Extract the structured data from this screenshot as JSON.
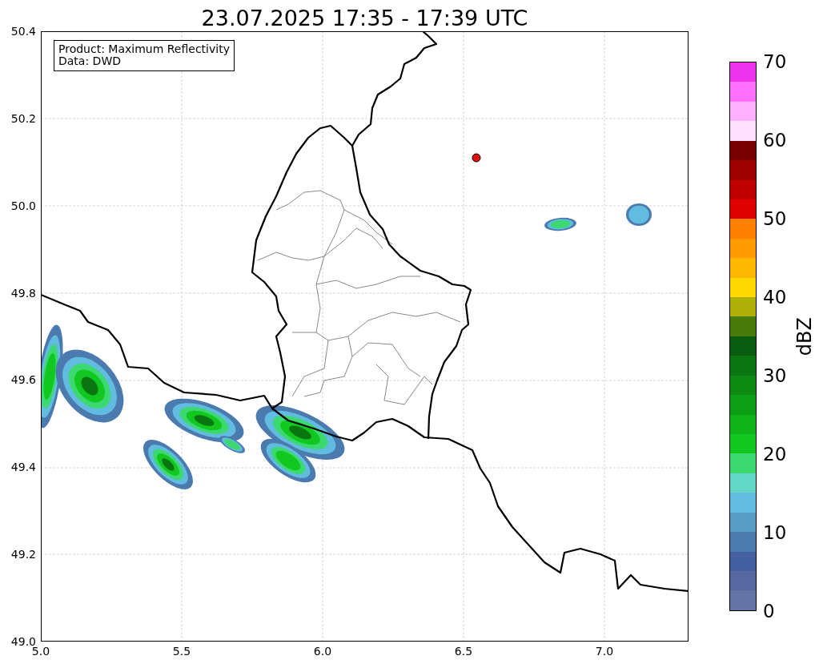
{
  "title": "23.07.2025 17:35 - 17:39 UTC",
  "legend": [
    "Product: Maximum Reflectivity",
    "Data: DWD"
  ],
  "map": {
    "xticks": [
      "5.0",
      "5.5",
      "6.0",
      "6.5",
      "7.0"
    ],
    "yticks": [
      "50.4",
      "50.2",
      "50.0",
      "49.8",
      "49.6",
      "49.4",
      "49.2",
      "49.0"
    ]
  },
  "colorbar": {
    "label": "dBZ",
    "ticks": [
      "70",
      "60",
      "50",
      "40",
      "30",
      "20",
      "10",
      "0"
    ],
    "bins": [
      {
        "color": "#ee33ee"
      },
      {
        "color": "#ff70ff"
      },
      {
        "color": "#ffb0ff"
      },
      {
        "color": "#ffe0ff"
      },
      {
        "color": "#780000"
      },
      {
        "color": "#a00000"
      },
      {
        "color": "#c00000"
      },
      {
        "color": "#e00000"
      },
      {
        "color": "#ff8000"
      },
      {
        "color": "#ff9a00"
      },
      {
        "color": "#ffb800"
      },
      {
        "color": "#ffd800"
      },
      {
        "color": "#b0b00a"
      },
      {
        "color": "#4a7a0a"
      },
      {
        "color": "#0a5c10"
      },
      {
        "color": "#0a7612"
      },
      {
        "color": "#0c8a12"
      },
      {
        "color": "#0e9e16"
      },
      {
        "color": "#10b418"
      },
      {
        "color": "#12c820"
      },
      {
        "color": "#3cd870"
      },
      {
        "color": "#62d8c8"
      },
      {
        "color": "#62bce0"
      },
      {
        "color": "#5a9ec8"
      },
      {
        "color": "#4a7aae"
      },
      {
        "color": "#4460a0"
      },
      {
        "color": "#56689f"
      },
      {
        "color": "#6474a6"
      }
    ]
  }
}
